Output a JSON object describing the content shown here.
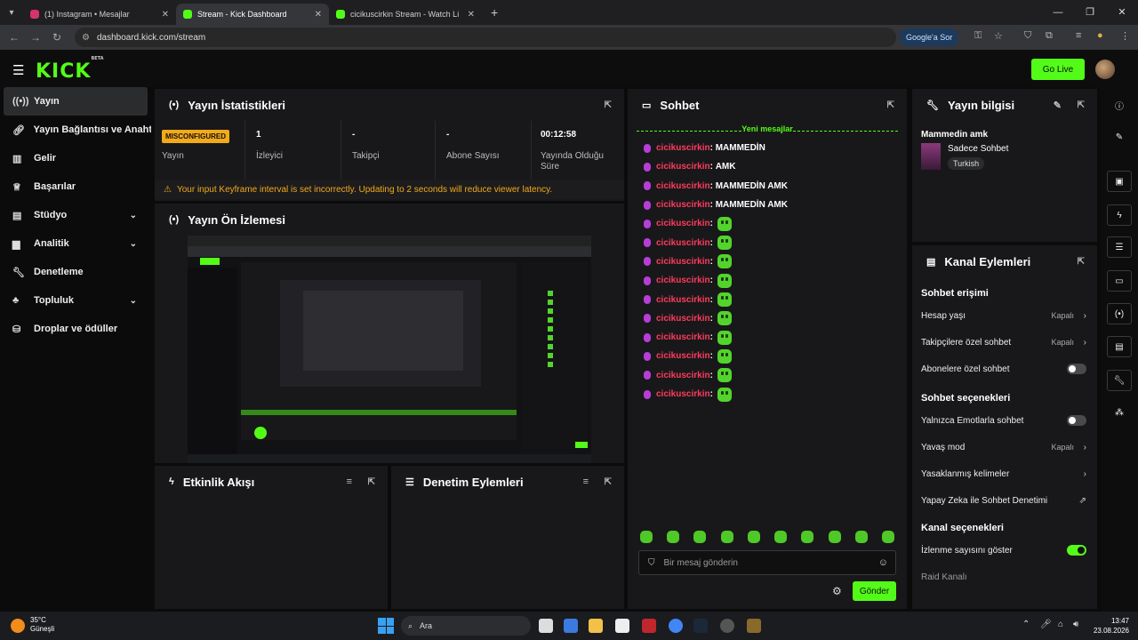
{
  "browser": {
    "tabs": [
      {
        "title": "(1) Instagram • Mesajlar",
        "color": "#d6336c"
      },
      {
        "title": "Stream - Kick Dashboard",
        "color": "#53fc18"
      },
      {
        "title": "cicikuscirkin Stream - Watch Li",
        "color": "#53fc18"
      }
    ],
    "url": "dashboard.kick.com/stream",
    "google_btn": "Google'a Sor"
  },
  "header": {
    "logo": "KICK",
    "beta": "BETA",
    "go_live": "Go Live"
  },
  "sidebar": {
    "items": [
      {
        "label": "Yayın",
        "icon": "broadcast-icon"
      },
      {
        "label": "Yayın Bağlantısı ve Anahtar",
        "icon": "link-icon"
      },
      {
        "label": "Gelir",
        "icon": "chart-icon"
      },
      {
        "label": "Başarılar",
        "icon": "trophy-icon"
      },
      {
        "label": "Stüdyo",
        "icon": "studio-icon"
      },
      {
        "label": "Analitik",
        "icon": "analytics-icon"
      },
      {
        "label": "Denetleme",
        "icon": "wrench-icon"
      },
      {
        "label": "Topluluk",
        "icon": "community-icon"
      },
      {
        "label": "Droplar ve ödüller",
        "icon": "gift-icon"
      }
    ]
  },
  "stats_panel": {
    "title": "Yayın İstatistikleri",
    "status_badge": "MISCONFIGURED",
    "stats": [
      {
        "value": "",
        "label": "Yayın"
      },
      {
        "value": "1",
        "label": "İzleyici"
      },
      {
        "value": "-",
        "label": "Takipçi"
      },
      {
        "value": "-",
        "label": "Abone Sayısı"
      },
      {
        "value": "00:12:58",
        "label": "Yayında Olduğu Süre"
      }
    ],
    "warning": "Your input Keyframe interval is set incorrectly. Updating to 2 seconds will reduce viewer latency."
  },
  "preview_panel": {
    "title": "Yayın Ön İzlemesi"
  },
  "activity_panel": {
    "title": "Etkinlik Akışı"
  },
  "moderation_panel": {
    "title": "Denetim Eylemleri"
  },
  "chat": {
    "title": "Sohbet",
    "new_messages": "Yeni mesajlar",
    "messages": [
      {
        "user": "cicikuscirkin",
        "text": "MAMMEDİN"
      },
      {
        "user": "cicikuscirkin",
        "text": "AMK"
      },
      {
        "user": "cicikuscirkin",
        "text": "MAMMEDİN AMK"
      },
      {
        "user": "cicikuscirkin",
        "text": "MAMMEDİN AMK"
      },
      {
        "user": "cicikuscirkin",
        "text": ""
      },
      {
        "user": "cicikuscirkin",
        "text": ""
      },
      {
        "user": "cicikuscirkin",
        "text": ""
      },
      {
        "user": "cicikuscirkin",
        "text": ""
      },
      {
        "user": "cicikuscirkin",
        "text": ""
      },
      {
        "user": "cicikuscirkin",
        "text": ""
      },
      {
        "user": "cicikuscirkin",
        "text": ""
      },
      {
        "user": "cicikuscirkin",
        "text": ""
      },
      {
        "user": "cicikuscirkin",
        "text": ""
      },
      {
        "user": "cicikuscirkin",
        "text": ""
      }
    ],
    "input_placeholder": "Bir mesaj gönderin",
    "send": "Gönder"
  },
  "stream_info": {
    "title": "Yayın bilgisi",
    "stream_title": "Mammedin amk",
    "category": "Sadece Sohbet",
    "tag": "Turkish"
  },
  "channel_actions": {
    "title": "Kanal Eylemleri",
    "chat_access": "Sohbet erişimi",
    "account_age": {
      "label": "Hesap yaşı",
      "value": "Kapalı"
    },
    "followers_only": {
      "label": "Takipçilere özel sohbet",
      "value": "Kapalı"
    },
    "subscribers_only": {
      "label": "Abonelere özel sohbet",
      "on": false
    },
    "chat_options": "Sohbet seçenekleri",
    "emote_only": {
      "label": "Yalnızca Emotlarla sohbet",
      "on": false
    },
    "slow_mode": {
      "label": "Yavaş mod",
      "value": "Kapalı"
    },
    "banned_words": "Yasaklanmış kelimeler",
    "ai_moderation": "Yapay Zeka ile Sohbet Denetimi",
    "channel_options": "Kanal seçenekleri",
    "show_viewers": {
      "label": "İzlenme sayısını göster",
      "on": true
    },
    "raid": "Raid Kanalı"
  },
  "taskbar": {
    "temp": "35°C",
    "weather": "Güneşli",
    "search": "Ara",
    "time": "13:47",
    "date": "23.08.2026"
  }
}
